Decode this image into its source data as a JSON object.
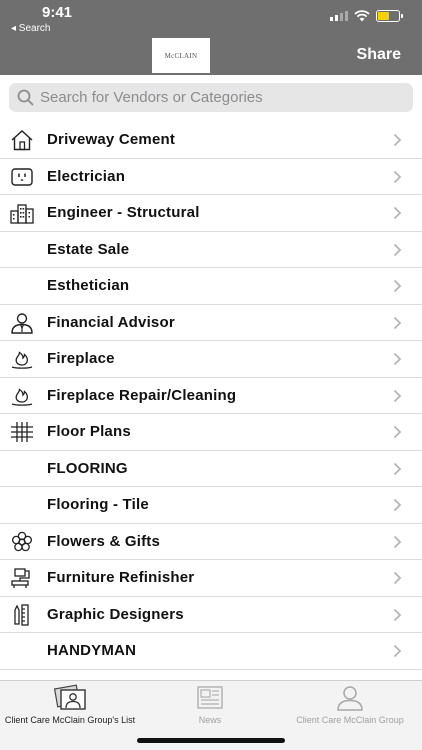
{
  "status_bar": {
    "time": "9:41",
    "back_label": "◂ Search"
  },
  "nav": {
    "logo_text": "McCLAIN",
    "share_label": "Share"
  },
  "search": {
    "placeholder": "Search for Vendors or Categories"
  },
  "rows": [
    {
      "label": "Driveway Cement",
      "icon": "house-icon"
    },
    {
      "label": "Electrician",
      "icon": "outlet-icon"
    },
    {
      "label": "Engineer - Structural",
      "icon": "buildings-icon"
    },
    {
      "label": "Estate Sale",
      "icon": ""
    },
    {
      "label": "Esthetician",
      "icon": ""
    },
    {
      "label": "Financial Advisor",
      "icon": "advisor-icon"
    },
    {
      "label": "Fireplace",
      "icon": "fire-icon"
    },
    {
      "label": "Fireplace Repair/Cleaning",
      "icon": "fire-icon"
    },
    {
      "label": "Floor Plans",
      "icon": "grid-icon"
    },
    {
      "label": "FLOORING",
      "icon": ""
    },
    {
      "label": "Flooring - Tile",
      "icon": ""
    },
    {
      "label": "Flowers & Gifts",
      "icon": "flower-icon"
    },
    {
      "label": "Furniture Refinisher",
      "icon": "brush-icon"
    },
    {
      "label": "Graphic Designers",
      "icon": "ruler-pencil-icon"
    },
    {
      "label": "HANDYMAN",
      "icon": ""
    }
  ],
  "tabs": [
    {
      "label": "Client Care McClain Group's List",
      "icon": "photos-icon",
      "active": true
    },
    {
      "label": "News",
      "icon": "newspaper-icon",
      "active": false
    },
    {
      "label": "Client Care McClain Group",
      "icon": "person-icon",
      "active": false
    }
  ],
  "colors": {
    "header_bg": "#6f6f70",
    "search_bg": "#e6e6e7",
    "battery": "#f5d200"
  }
}
